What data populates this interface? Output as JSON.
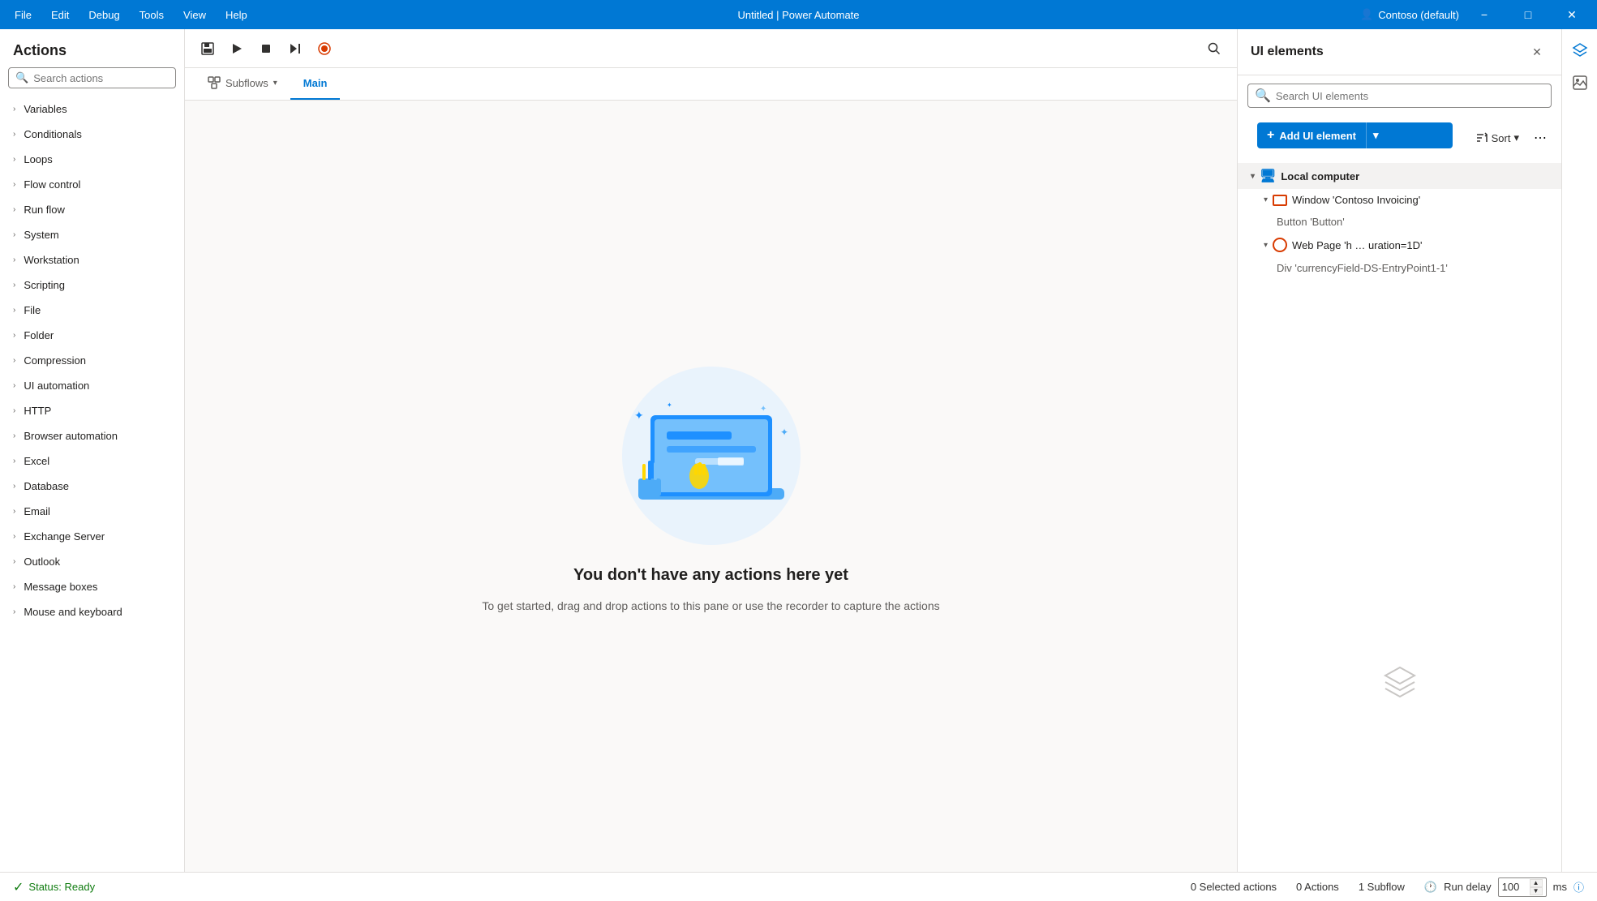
{
  "titlebar": {
    "menu_items": [
      "File",
      "Edit",
      "Debug",
      "Tools",
      "View",
      "Help"
    ],
    "title": "Untitled | Power Automate",
    "account": "Contoso (default)",
    "min_btn": "−",
    "max_btn": "□",
    "close_btn": "✕"
  },
  "actions_panel": {
    "title": "Actions",
    "search_placeholder": "Search actions",
    "items": [
      "Variables",
      "Conditionals",
      "Loops",
      "Flow control",
      "Run flow",
      "System",
      "Workstation",
      "Scripting",
      "File",
      "Folder",
      "Compression",
      "UI automation",
      "HTTP",
      "Browser automation",
      "Excel",
      "Database",
      "Email",
      "Exchange Server",
      "Outlook",
      "Message boxes",
      "Mouse and keyboard"
    ]
  },
  "toolbar": {
    "save_tooltip": "Save",
    "run_tooltip": "Run",
    "stop_tooltip": "Stop",
    "next_tooltip": "Next",
    "record_tooltip": "Record"
  },
  "tabs": {
    "subflows_label": "Subflows",
    "main_label": "Main"
  },
  "canvas": {
    "empty_title": "You don't have any actions here yet",
    "empty_subtitle": "To get started, drag and drop actions to this pane\nor use the recorder to capture the actions"
  },
  "ui_elements_panel": {
    "title": "UI elements",
    "search_placeholder": "Search UI elements",
    "add_btn_label": "Add UI element",
    "sort_label": "Sort",
    "tree": {
      "local_computer": "Local computer",
      "window_label": "Window 'Contoso Invoicing'",
      "button_label": "Button 'Button'",
      "webpage_label": "Web Page 'h … uration=1D'",
      "div_label": "Div 'currencyField-DS-EntryPoint1-1'"
    }
  },
  "statusbar": {
    "status_label": "Status: Ready",
    "selected_actions": "0 Selected actions",
    "actions_count": "0 Actions",
    "subflow_count": "1 Subflow",
    "run_delay_label": "Run delay",
    "run_delay_value": "100",
    "ms_label": "ms"
  }
}
